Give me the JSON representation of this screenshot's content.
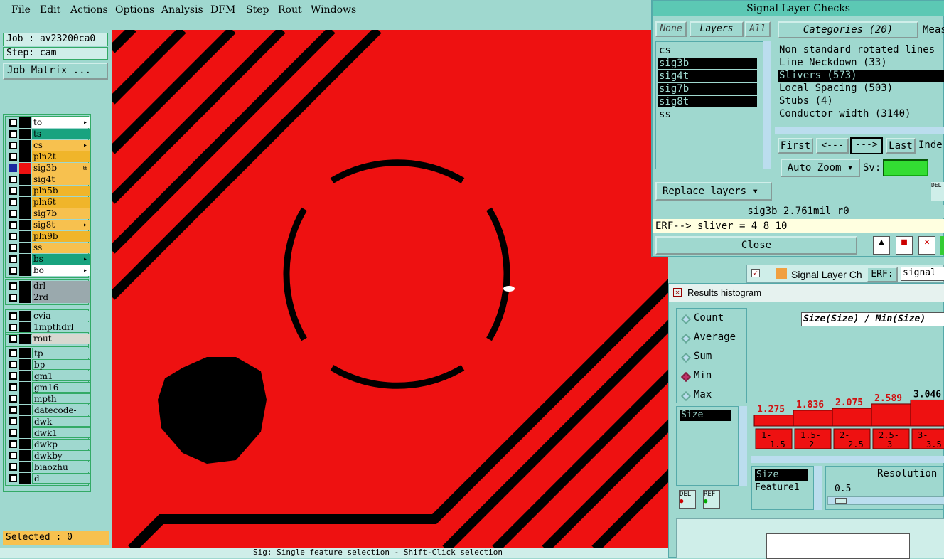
{
  "menu": {
    "items": [
      "File",
      "Edit",
      "Actions",
      "Options",
      "Analysis",
      "DFM",
      "Step",
      "Rout",
      "Windows"
    ]
  },
  "job": {
    "job_label": "Job : av23200ca0",
    "step_label": "Step: cam",
    "matrix_button": "Job Matrix ..."
  },
  "layers": {
    "group1": [
      {
        "name": "to",
        "color": "#ffffff",
        "sel": false,
        "mark": "▸"
      },
      {
        "name": "ts",
        "color": "#19a37f",
        "sel": false,
        "mark": ""
      },
      {
        "name": "cs",
        "color": "#f7c14f",
        "sel": false,
        "mark": "▸"
      },
      {
        "name": "pln2t",
        "color": "#f0b52a",
        "sel": false,
        "mark": ""
      },
      {
        "name": "sig3b",
        "color": "#f7c14f",
        "sel": true,
        "mark": "⊞"
      },
      {
        "name": "sig4t",
        "color": "#f7c14f",
        "sel": false,
        "mark": ""
      },
      {
        "name": "pln5b",
        "color": "#f0b52a",
        "sel": false,
        "mark": ""
      },
      {
        "name": "pln6t",
        "color": "#f0b52a",
        "sel": false,
        "mark": ""
      },
      {
        "name": "sig7b",
        "color": "#f7c14f",
        "sel": false,
        "mark": ""
      },
      {
        "name": "sig8t",
        "color": "#f7c14f",
        "sel": false,
        "mark": "▸"
      },
      {
        "name": "pln9b",
        "color": "#f0b52a",
        "sel": false,
        "mark": ""
      },
      {
        "name": "ss",
        "color": "#f7c14f",
        "sel": false,
        "mark": ""
      },
      {
        "name": "bs",
        "color": "#19a37f",
        "sel": false,
        "mark": "▸"
      },
      {
        "name": "bo",
        "color": "#ffffff",
        "sel": false,
        "mark": "▸"
      }
    ],
    "group2": [
      {
        "name": "drl",
        "color": "#9aa9ad"
      },
      {
        "name": "2rd",
        "color": "#9aa9ad"
      }
    ],
    "group3": [
      {
        "name": "cvia",
        "color": "#9fd8cf"
      },
      {
        "name": "1mpthdrl",
        "color": "#9fd8cf"
      }
    ],
    "group4": [
      {
        "name": "rout",
        "color": "#d8d8d0"
      }
    ],
    "group5": [
      {
        "name": "tp"
      },
      {
        "name": "bp"
      },
      {
        "name": "gm1"
      },
      {
        "name": "gm16"
      },
      {
        "name": "mpth"
      },
      {
        "name": "datecode-ptc"
      },
      {
        "name": "dwk"
      },
      {
        "name": "dwk1"
      },
      {
        "name": "dwkp"
      },
      {
        "name": "dwkby"
      },
      {
        "name": "biaozhu"
      },
      {
        "name": "d"
      }
    ]
  },
  "selected_label": "Selected : 0",
  "bottom_status": "Sig: Single feature selection - Shift-Click selection",
  "slc": {
    "title": "Signal Layer Checks",
    "btn_none": "None",
    "btn_layers": "Layers",
    "btn_all": "All",
    "layer_list": [
      {
        "name": "cs",
        "sel": false
      },
      {
        "name": "sig3b",
        "sel": true
      },
      {
        "name": "sig4t",
        "sel": true
      },
      {
        "name": "sig7b",
        "sel": true
      },
      {
        "name": "sig8t",
        "sel": true
      },
      {
        "name": "ss",
        "sel": false
      }
    ],
    "categories_button": "Categories (20)",
    "meas_label": "Meas",
    "categories": [
      {
        "label": "Non standard rotated lines",
        "sel": false
      },
      {
        "label": "Line Neckdown (33)",
        "sel": false
      },
      {
        "label": "Slivers (573)",
        "sel": true
      },
      {
        "label": "Local Spacing (503)",
        "sel": false
      },
      {
        "label": "Stubs (4)",
        "sel": false
      },
      {
        "label": "Conductor width (3140)",
        "sel": false
      }
    ],
    "nav": {
      "first": "First",
      "prev": "<---",
      "next": "--->",
      "last": "Last",
      "index": "Inde"
    },
    "auto_zoom": "Auto Zoom",
    "sv_label": "Sv:",
    "replace_layers": "Replace layers",
    "info": "sig3b 2.761mil  r0",
    "erf": "ERF--> sliver = 4 8 10",
    "close": "Close",
    "del": "DEL"
  },
  "second_window": {
    "title": "Signal Layer Ch",
    "erf_label": "ERF:",
    "erf_value": "signal"
  },
  "hist": {
    "title": "Results histogram",
    "modes": [
      {
        "label": "Count",
        "on": false
      },
      {
        "label": "Average",
        "on": false
      },
      {
        "label": "Sum",
        "on": false
      },
      {
        "label": "Min",
        "on": true
      },
      {
        "label": "Max",
        "on": false
      }
    ],
    "size_item": "Size",
    "header": "Size(Size) / Min(Size)",
    "del": "DEL",
    "ref": "REF",
    "list2": [
      "Size",
      "Feature1"
    ],
    "resolution_label": "Resolution",
    "resolution_value": "0.5"
  },
  "chart_data": {
    "type": "bar",
    "categories": [
      "1-1.5",
      "1.5-2",
      "2-2.5",
      "2.5-3",
      "3-3.5"
    ],
    "values": [
      1.275,
      1.836,
      2.075,
      2.589,
      3.046
    ],
    "value_labels": [
      "1.275",
      "1.836",
      "2.075",
      "2.589",
      "3.046"
    ],
    "title": "Size(Size) / Min(Size)",
    "bar_color": "#ee1111"
  }
}
